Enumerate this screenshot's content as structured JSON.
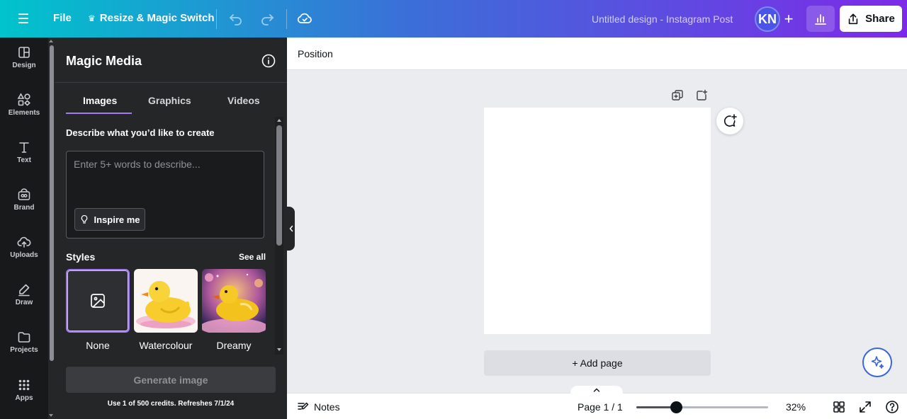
{
  "topbar": {
    "file_label": "File",
    "resize_label": "Resize & Magic Switch",
    "design_title": "Untitled design - Instagram Post",
    "avatar_initials": "KN",
    "share_label": "Share",
    "gradient_start": "#00c4cc",
    "gradient_end": "#7d2ae8"
  },
  "rail": {
    "items": [
      {
        "label": "Design",
        "icon": "design-icon"
      },
      {
        "label": "Elements",
        "icon": "elements-icon"
      },
      {
        "label": "Text",
        "icon": "text-icon"
      },
      {
        "label": "Brand",
        "icon": "brand-icon"
      },
      {
        "label": "Uploads",
        "icon": "uploads-icon"
      },
      {
        "label": "Draw",
        "icon": "draw-icon"
      },
      {
        "label": "Projects",
        "icon": "projects-icon"
      },
      {
        "label": "Apps",
        "icon": "apps-icon"
      }
    ]
  },
  "panel": {
    "title": "Magic Media",
    "tabs": [
      {
        "label": "Images",
        "active": true
      },
      {
        "label": "Graphics",
        "active": false
      },
      {
        "label": "Videos",
        "active": false
      }
    ],
    "describe_label": "Describe what you’d like to create",
    "prompt_placeholder": "Enter 5+ words to describe...",
    "prompt_value": "",
    "inspire_label": "Inspire me",
    "styles_label": "Styles",
    "see_all_label": "See all",
    "styles": [
      {
        "name": "None",
        "selected": true
      },
      {
        "name": "Watercolour",
        "selected": false
      },
      {
        "name": "Dreamy",
        "selected": false
      }
    ],
    "generate_label": "Generate image",
    "credits_text": "Use 1 of 500 credits. Refreshes 7/1/24",
    "accent_color": "#a479f6"
  },
  "canvas": {
    "position_label": "Position",
    "add_page_label": "+ Add page"
  },
  "bottombar": {
    "notes_label": "Notes",
    "page_indicator": "Page 1 / 1",
    "zoom_label": "32%",
    "zoom_fraction": 0.3
  }
}
